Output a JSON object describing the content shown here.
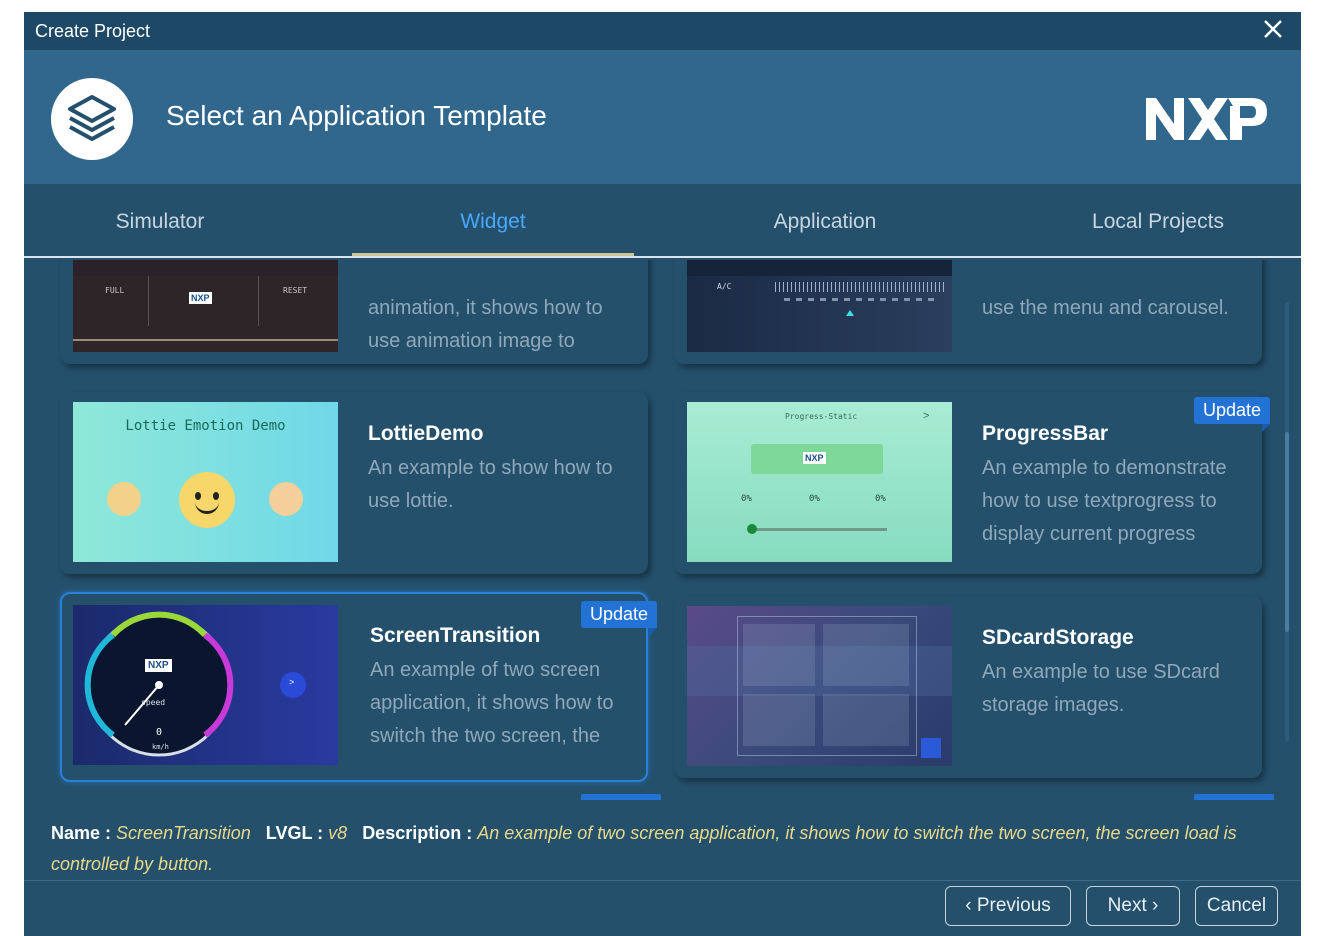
{
  "window": {
    "title": "Create Project"
  },
  "header": {
    "heading": "Select an Application Template",
    "brand": "NXP"
  },
  "tabs": [
    {
      "label": "Simulator",
      "active": false
    },
    {
      "label": "Widget",
      "active": true
    },
    {
      "label": "Application",
      "active": false
    },
    {
      "label": "Local Projects",
      "active": false
    }
  ],
  "cards": {
    "partial_left": {
      "desc": "animation, it shows how to use animation image to",
      "thumb": {
        "full": "FULL",
        "reset": "RESET",
        "logo": "NXP"
      }
    },
    "partial_right": {
      "desc": "use the menu and carousel.",
      "thumb": {
        "ac": "A/C"
      }
    },
    "lottie": {
      "title": "LottieDemo",
      "desc": "An example to show how to use lottie.",
      "thumb": {
        "caption": "Lottie Emotion Demo"
      }
    },
    "progress": {
      "title": "ProgressBar",
      "desc": "An example to demonstrate how to use textprogress to display current progress",
      "badge": "Update",
      "thumb": {
        "header": "Progress-Static",
        "arrow": ">",
        "logo": "NXP",
        "pct1": "0%",
        "pct2": "0%",
        "pct3": "0%"
      }
    },
    "screen": {
      "title": "ScreenTransition",
      "desc": "An example of two screen application, it shows how to switch the two screen, the",
      "badge": "Update",
      "thumb": {
        "logo": "NXP",
        "speed": "speed",
        "value": "0",
        "unit": "km/h",
        "next": ">"
      }
    },
    "sdcard": {
      "title": "SDcardStorage",
      "desc": "An example to use SDcard storage images."
    }
  },
  "info": {
    "name_label": "Name :",
    "name_value": "ScreenTransition",
    "lvgl_label": "LVGL :",
    "lvgl_value": "v8",
    "desc_label": "Description :",
    "desc_value": "An example of two screen application, it shows how to switch the two screen, the screen load is controlled by button."
  },
  "buttons": {
    "previous": "Previous",
    "next": "Next",
    "cancel": "Cancel"
  },
  "colors": {
    "dialog_bg": "#24506c",
    "header_bg": "#31678c",
    "accent": "#49a8ff",
    "badge": "#2373d6",
    "info_value": "#e8d88a"
  }
}
